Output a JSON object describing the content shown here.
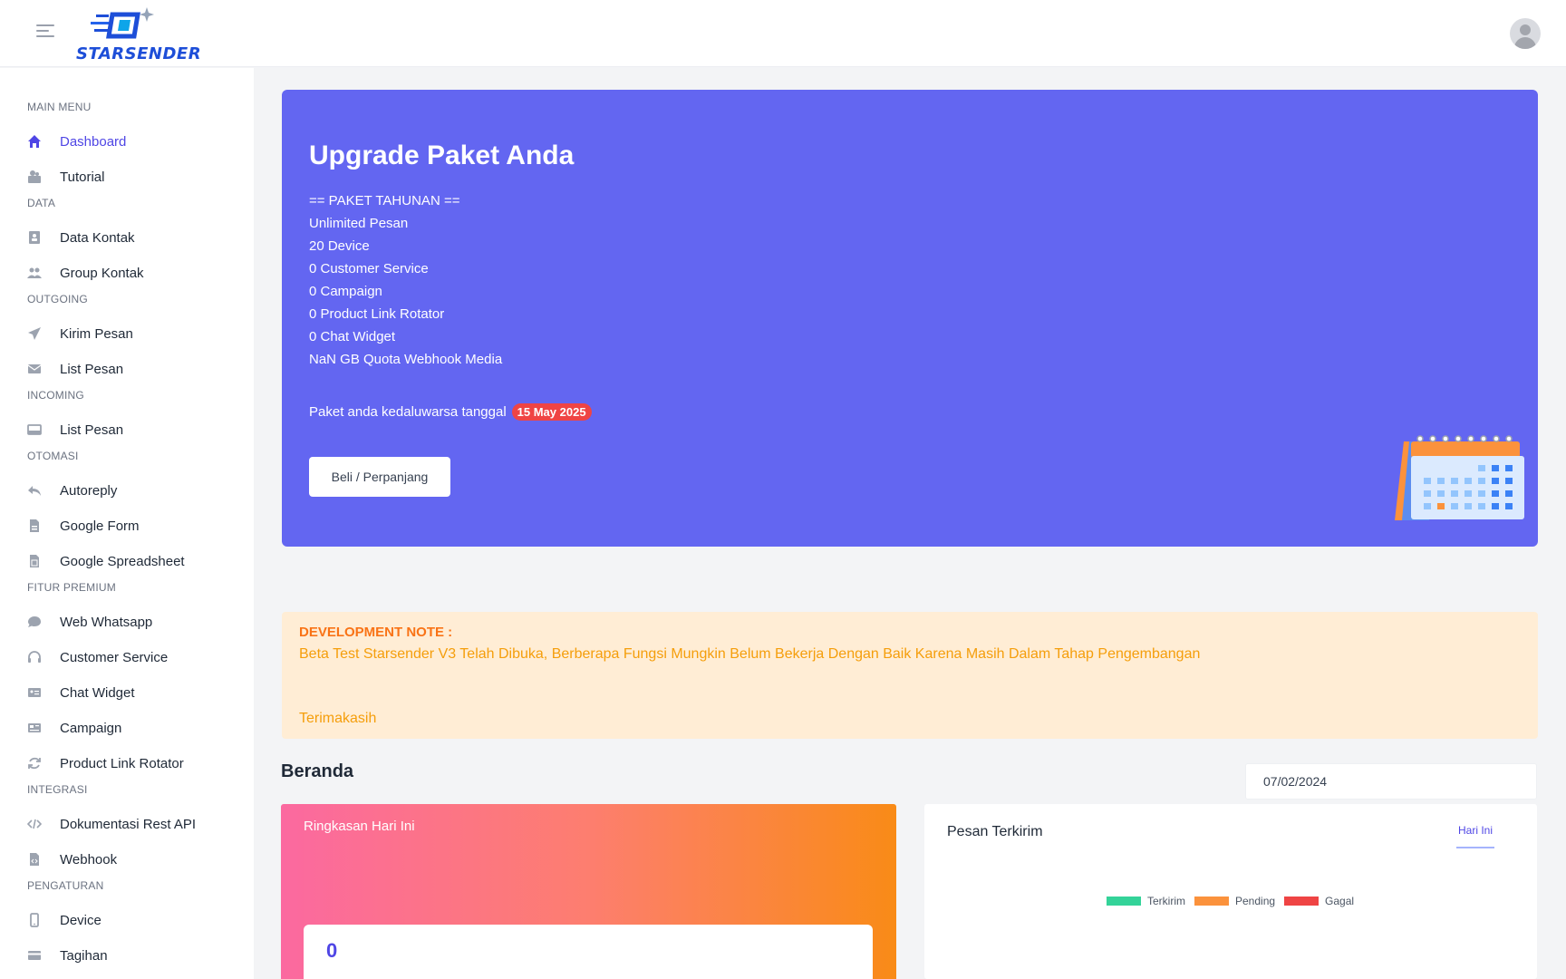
{
  "app": {
    "logo_text": "STARSENDER"
  },
  "sidebar": {
    "sections": {
      "main": "MAIN MENU",
      "data": "DATA",
      "outgoing": "OUTGOING",
      "incoming": "INCOMING",
      "otomasi": "OTOMASI",
      "premium": "FITUR PREMIUM",
      "integrasi": "INTEGRASI",
      "pengaturan": "PENGATURAN"
    },
    "items": {
      "dashboard": "Dashboard",
      "tutorial": "Tutorial",
      "data_kontak": "Data Kontak",
      "group_kontak": "Group Kontak",
      "kirim_pesan": "Kirim Pesan",
      "list_pesan_out": "List Pesan",
      "list_pesan_in": "List Pesan",
      "autoreply": "Autoreply",
      "google_form": "Google Form",
      "google_spreadsheet": "Google Spreadsheet",
      "web_whatsapp": "Web Whatsapp",
      "customer_service": "Customer Service",
      "chat_widget": "Chat Widget",
      "campaign": "Campaign",
      "product_link_rotator": "Product Link Rotator",
      "dokumentasi": "Dokumentasi Rest API",
      "webhook": "Webhook",
      "device": "Device",
      "tagihan": "Tagihan"
    }
  },
  "upgrade": {
    "title": "Upgrade Paket Anda",
    "features": [
      "== PAKET TAHUNAN ==",
      "Unlimited Pesan",
      "20 Device",
      "0 Customer Service",
      "0 Campaign",
      "0 Product Link Rotator",
      "0 Chat Widget",
      "NaN GB Quota Webhook Media"
    ],
    "expiry_text": "Paket anda kedaluwarsa tanggal",
    "expiry_date": "15 May 2025",
    "button": "Beli / Perpanjang"
  },
  "devnote": {
    "title": "DEVELOPMENT NOTE :",
    "message": "Beta Test Starsender V3 Telah Dibuka, Berberapa Fungsi Mungkin Belum Bekerja Dengan Baik Karena Masih Dalam Tahap Pengembangan",
    "thanks": "Terimakasih"
  },
  "beranda": {
    "title": "Beranda",
    "date": "07/02/2024"
  },
  "summary": {
    "title": "Ringkasan Hari Ini",
    "value": "0"
  },
  "sent": {
    "title": "Pesan Terkirim",
    "tab": "Hari Ini",
    "legend": [
      {
        "label": "Terkirim",
        "color": "#34d399"
      },
      {
        "label": "Pending",
        "color": "#fb923c"
      },
      {
        "label": "Gagal",
        "color": "#ef4444"
      }
    ]
  },
  "colors": {
    "accent": "#6366f1",
    "primary_text": "#4f46e5",
    "warning": "#f59e0b"
  }
}
